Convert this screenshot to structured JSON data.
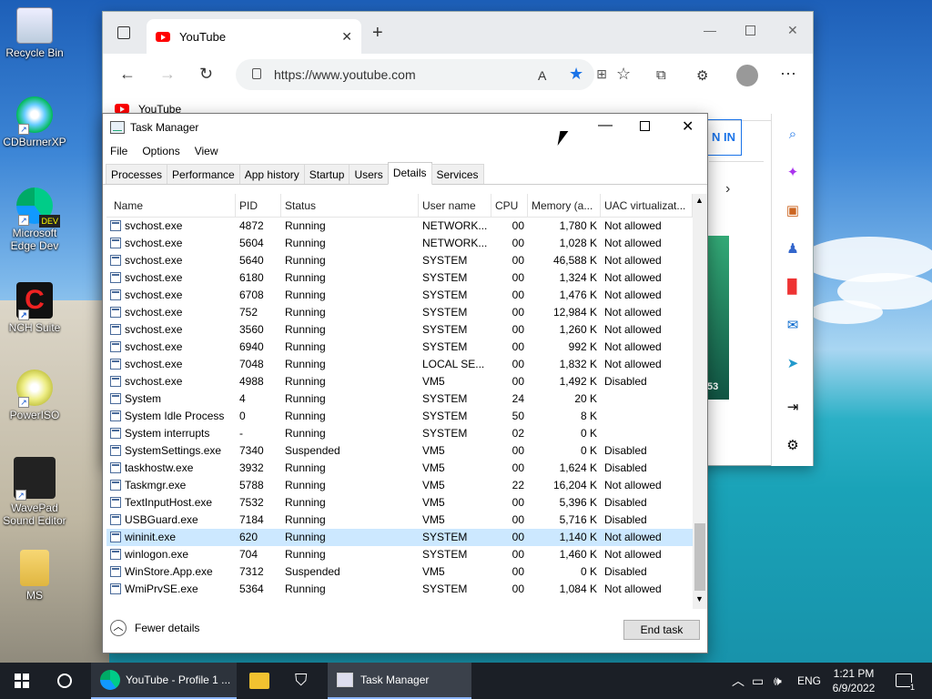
{
  "desktop": {
    "icons": [
      {
        "label": "Recycle Bin"
      },
      {
        "label": "CDBurnerXP"
      },
      {
        "label": "Microsoft Edge Dev"
      },
      {
        "label": "NCH Suite"
      },
      {
        "label": "PowerISO"
      },
      {
        "label": "WavePad Sound Editor"
      },
      {
        "label": "MS"
      }
    ]
  },
  "browser": {
    "tab_title": "YouTube",
    "url": "https://www.youtube.com",
    "favorite": "YouTube",
    "sign_in_partial": "N IN"
  },
  "taskmgr": {
    "title": "Task Manager",
    "menu": [
      "File",
      "Options",
      "View"
    ],
    "tabs": [
      "Processes",
      "Performance",
      "App history",
      "Startup",
      "Users",
      "Details",
      "Services"
    ],
    "active_tab": "Details",
    "columns": [
      "Name",
      "PID",
      "Status",
      "User name",
      "CPU",
      "Memory (a...",
      "UAC virtualizat..."
    ],
    "rows": [
      {
        "name": "svchost.exe",
        "pid": "4872",
        "status": "Running",
        "user": "NETWORK...",
        "cpu": "00",
        "mem": "1,780 K",
        "uac": "Not allowed"
      },
      {
        "name": "svchost.exe",
        "pid": "5604",
        "status": "Running",
        "user": "NETWORK...",
        "cpu": "00",
        "mem": "1,028 K",
        "uac": "Not allowed"
      },
      {
        "name": "svchost.exe",
        "pid": "5640",
        "status": "Running",
        "user": "SYSTEM",
        "cpu": "00",
        "mem": "46,588 K",
        "uac": "Not allowed"
      },
      {
        "name": "svchost.exe",
        "pid": "6180",
        "status": "Running",
        "user": "SYSTEM",
        "cpu": "00",
        "mem": "1,324 K",
        "uac": "Not allowed"
      },
      {
        "name": "svchost.exe",
        "pid": "6708",
        "status": "Running",
        "user": "SYSTEM",
        "cpu": "00",
        "mem": "1,476 K",
        "uac": "Not allowed"
      },
      {
        "name": "svchost.exe",
        "pid": "752",
        "status": "Running",
        "user": "SYSTEM",
        "cpu": "00",
        "mem": "12,984 K",
        "uac": "Not allowed"
      },
      {
        "name": "svchost.exe",
        "pid": "3560",
        "status": "Running",
        "user": "SYSTEM",
        "cpu": "00",
        "mem": "1,260 K",
        "uac": "Not allowed"
      },
      {
        "name": "svchost.exe",
        "pid": "6940",
        "status": "Running",
        "user": "SYSTEM",
        "cpu": "00",
        "mem": "992 K",
        "uac": "Not allowed"
      },
      {
        "name": "svchost.exe",
        "pid": "7048",
        "status": "Running",
        "user": "LOCAL SE...",
        "cpu": "00",
        "mem": "1,832 K",
        "uac": "Not allowed"
      },
      {
        "name": "svchost.exe",
        "pid": "4988",
        "status": "Running",
        "user": "VM5",
        "cpu": "00",
        "mem": "1,492 K",
        "uac": "Disabled"
      },
      {
        "name": "System",
        "pid": "4",
        "status": "Running",
        "user": "SYSTEM",
        "cpu": "24",
        "mem": "20 K",
        "uac": ""
      },
      {
        "name": "System Idle Process",
        "pid": "0",
        "status": "Running",
        "user": "SYSTEM",
        "cpu": "50",
        "mem": "8 K",
        "uac": ""
      },
      {
        "name": "System interrupts",
        "pid": "-",
        "status": "Running",
        "user": "SYSTEM",
        "cpu": "02",
        "mem": "0 K",
        "uac": ""
      },
      {
        "name": "SystemSettings.exe",
        "pid": "7340",
        "status": "Suspended",
        "user": "VM5",
        "cpu": "00",
        "mem": "0 K",
        "uac": "Disabled"
      },
      {
        "name": "taskhostw.exe",
        "pid": "3932",
        "status": "Running",
        "user": "VM5",
        "cpu": "00",
        "mem": "1,624 K",
        "uac": "Disabled"
      },
      {
        "name": "Taskmgr.exe",
        "pid": "5788",
        "status": "Running",
        "user": "VM5",
        "cpu": "22",
        "mem": "16,204 K",
        "uac": "Not allowed"
      },
      {
        "name": "TextInputHost.exe",
        "pid": "7532",
        "status": "Running",
        "user": "VM5",
        "cpu": "00",
        "mem": "5,396 K",
        "uac": "Disabled"
      },
      {
        "name": "USBGuard.exe",
        "pid": "7184",
        "status": "Running",
        "user": "VM5",
        "cpu": "00",
        "mem": "5,716 K",
        "uac": "Disabled"
      },
      {
        "name": "wininit.exe",
        "pid": "620",
        "status": "Running",
        "user": "SYSTEM",
        "cpu": "00",
        "mem": "1,140 K",
        "uac": "Not allowed",
        "selected": true
      },
      {
        "name": "winlogon.exe",
        "pid": "704",
        "status": "Running",
        "user": "SYSTEM",
        "cpu": "00",
        "mem": "1,460 K",
        "uac": "Not allowed"
      },
      {
        "name": "WinStore.App.exe",
        "pid": "7312",
        "status": "Suspended",
        "user": "VM5",
        "cpu": "00",
        "mem": "0 K",
        "uac": "Disabled"
      },
      {
        "name": "WmiPrvSE.exe",
        "pid": "5364",
        "status": "Running",
        "user": "SYSTEM",
        "cpu": "00",
        "mem": "1,084 K",
        "uac": "Not allowed"
      }
    ],
    "fewer_details": "Fewer details",
    "end_task": "End task"
  },
  "taskbar": {
    "items": [
      "YouTube - Profile 1 ...",
      "Task Manager"
    ],
    "lang": "ENG",
    "time": "1:21 PM",
    "date": "6/9/2022",
    "notif_count": "1"
  }
}
